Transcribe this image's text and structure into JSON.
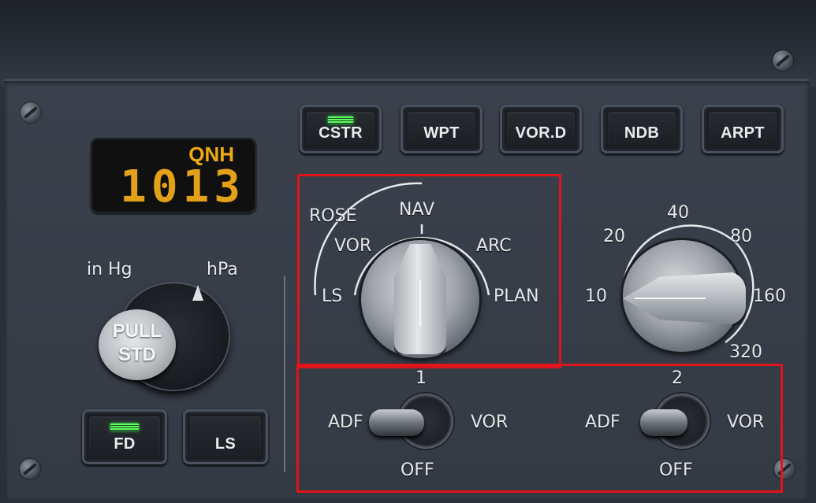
{
  "nd_buttons": [
    {
      "label": "CSTR",
      "lit": true
    },
    {
      "label": "WPT",
      "lit": false
    },
    {
      "label": "VOR.D",
      "lit": false
    },
    {
      "label": "NDB",
      "lit": false
    },
    {
      "label": "ARPT",
      "lit": false
    }
  ],
  "baro": {
    "title": "QNH",
    "value": "1013",
    "unit_left": "in Hg",
    "unit_right": "hPa",
    "pull_line1": "PULL",
    "pull_line2": "STD"
  },
  "bottom_buttons": [
    {
      "label": "FD",
      "lit": true
    },
    {
      "label": "LS",
      "lit": false
    }
  ],
  "mode_selector": {
    "positions": [
      "ROSE",
      "NAV",
      "VOR",
      "ARC",
      "LS",
      "PLAN"
    ],
    "selected": "NAV"
  },
  "range_selector": {
    "values": [
      "10",
      "20",
      "40",
      "80",
      "160",
      "320"
    ],
    "selected": "160"
  },
  "adf_vor_switches": [
    {
      "number": "1",
      "left": "ADF",
      "right": "VOR",
      "bottom": "OFF"
    },
    {
      "number": "2",
      "left": "ADF",
      "right": "VOR",
      "bottom": "OFF"
    }
  ],
  "colors": {
    "highlight": "#e2141b",
    "display_amber": "#e2a119",
    "annunciator_green": "#62ff66"
  }
}
